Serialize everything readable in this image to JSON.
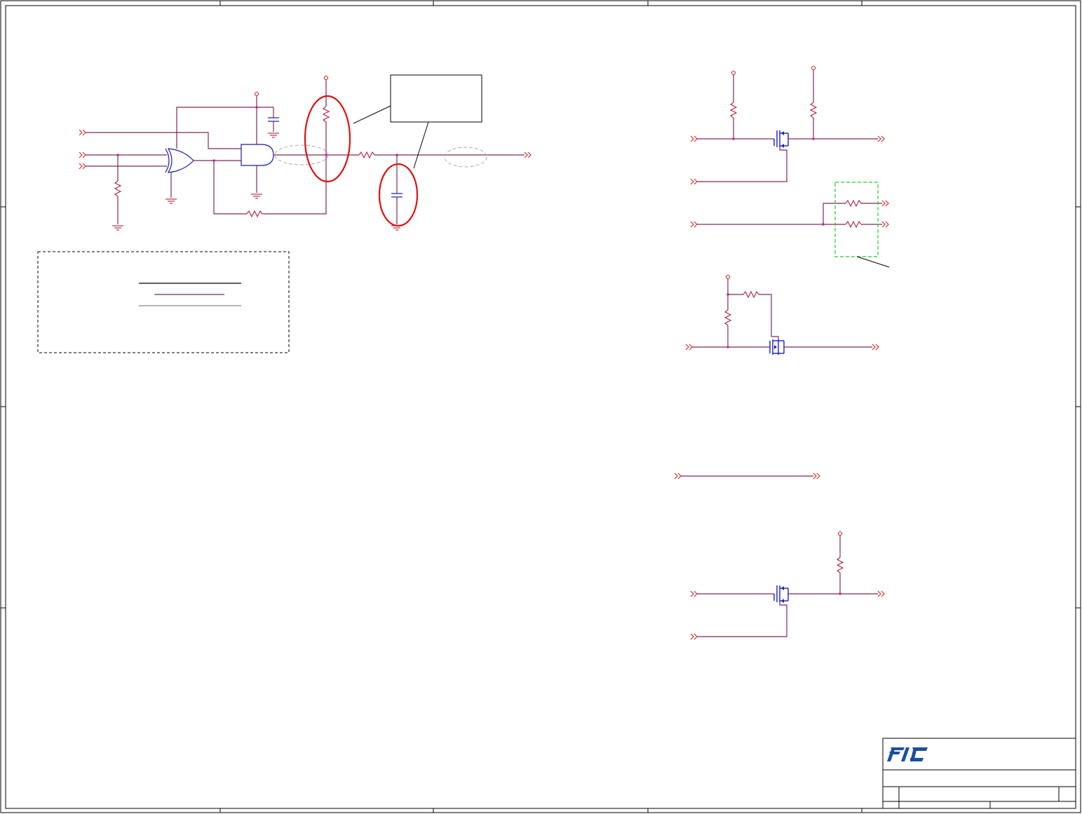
{
  "title_block": {
    "logo": "FIC",
    "logo_color": "#1a4fa0"
  },
  "colors": {
    "wire": "#7a2a5a",
    "component": "#b0203a",
    "gate": "#1a1aa8",
    "mosfet": "#1a1acc",
    "highlight_circle": "#e01010",
    "dashed_highlight": "#22cc22",
    "dashed_ellipse": "#aaaaaa"
  },
  "icons": [
    "resistor-icon",
    "capacitor-icon",
    "xor-gate-icon",
    "and-gate-icon",
    "mosfet-icon",
    "ground-icon",
    "power-rail-icon",
    "offpage-connector-icon"
  ]
}
